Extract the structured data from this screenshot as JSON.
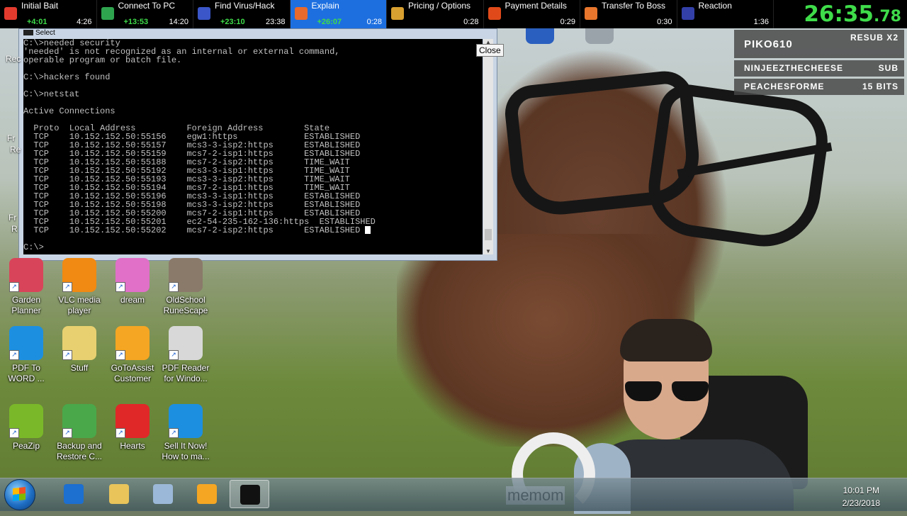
{
  "splits": [
    {
      "name": "Initial Bait",
      "delta": "+4:01",
      "time": "4:26",
      "icon_color": "#e23b2e"
    },
    {
      "name": "Connect To PC",
      "delta": "+13:53",
      "time": "14:20",
      "icon_color": "#2fa44f"
    },
    {
      "name": "Find Virus/Hack",
      "delta": "+23:10",
      "time": "23:38",
      "icon_color": "#3a56c8"
    },
    {
      "name": "Explain",
      "delta": "+26:07",
      "time": "0:28",
      "icon_color": "#e86a2c"
    },
    {
      "name": "Pricing / Options",
      "delta": "",
      "time": "0:28",
      "icon_color": "#d8a030"
    },
    {
      "name": "Payment Details",
      "delta": "",
      "time": "0:29",
      "icon_color": "#e04a1a"
    },
    {
      "name": "Transfer To Boss",
      "delta": "",
      "time": "0:30",
      "icon_color": "#e8762c"
    },
    {
      "name": "Reaction",
      "delta": "",
      "time": "1:36",
      "icon_color": "#3340a8"
    }
  ],
  "active_split_index": 3,
  "timer": {
    "main": "26:35",
    "centis": ".78"
  },
  "subs": [
    {
      "user": "PIKO610",
      "type": "RESUB X2"
    },
    {
      "user": "NINJEEZTHECHEESE",
      "type": "SUB"
    },
    {
      "user": "PEACHESFORME",
      "type": "15 BITS"
    }
  ],
  "cmd": {
    "title": "Select",
    "lines": [
      "C:\\>needed security",
      "'needed' is not recognized as an internal or external command,",
      "operable program or batch file.",
      "",
      "C:\\>hackers found",
      "",
      "C:\\>netstat",
      "",
      "Active Connections",
      "",
      "  Proto  Local Address          Foreign Address        State",
      "  TCP    10.152.152.50:55156    egw1:https             ESTABLISHED",
      "  TCP    10.152.152.50:55157    mcs3-3-isp2:https      ESTABLISHED",
      "  TCP    10.152.152.50:55159    mcs7-2-isp1:https      ESTABLISHED",
      "  TCP    10.152.152.50:55188    mcs7-2-isp2:https      TIME_WAIT",
      "  TCP    10.152.152.50:55192    mcs3-3-isp1:https      TIME_WAIT",
      "  TCP    10.152.152.50:55193    mcs3-3-isp2:https      TIME_WAIT",
      "  TCP    10.152.152.50:55194    mcs7-2-isp1:https      TIME_WAIT",
      "  TCP    10.152.152.50:55196    mcs3-3-isp1:https      ESTABLISHED",
      "  TCP    10.152.152.50:55198    mcs3-3-isp2:https      ESTABLISHED",
      "  TCP    10.152.152.50:55200    mcs7-2-isp1:https      ESTABLISHED",
      "  TCP    10.152.152.50:55201    ec2-54-235-162-136:https  ESTABLISHED",
      "  TCP    10.152.152.50:55202    mcs7-2-isp2:https      ESTABLISHED ",
      "",
      "C:\\>"
    ],
    "close_tooltip": "Close"
  },
  "desktop_icons": [
    {
      "label": "Garden Planner",
      "color": "#d8455a"
    },
    {
      "label": "VLC media player",
      "color": "#f08a12"
    },
    {
      "label": "dream",
      "color": "#e070c8"
    },
    {
      "label": "OldSchool RuneScape",
      "color": "#8a7a6a"
    },
    {
      "label": "PDF To WORD ...",
      "color": "#1d8fe0"
    },
    {
      "label": "Stuff",
      "color": "#e8d070"
    },
    {
      "label": "GoToAssist Customer",
      "color": "#f5a623"
    },
    {
      "label": "PDF Reader for Windo...",
      "color": "#d8d8d8"
    },
    {
      "label": "PeaZip",
      "color": "#7ab829"
    },
    {
      "label": "Backup and Restore C...",
      "color": "#4aa84a"
    },
    {
      "label": "Hearts",
      "color": "#e02828"
    },
    {
      "label": "Sell It Now! How to ma...",
      "color": "#1d8fe0"
    }
  ],
  "edge_labels": [
    "Rec",
    "Fr",
    "Re",
    "Fr",
    "R"
  ],
  "webcam_overlay": "memom",
  "clock": {
    "time": "10:01 PM",
    "date": "2/23/2018"
  },
  "taskbar_icons": [
    {
      "name": "ie-icon",
      "color": "#1d6fd0"
    },
    {
      "name": "explorer-icon",
      "color": "#e8c45a"
    },
    {
      "name": "calculator-icon",
      "color": "#9bb8d8"
    },
    {
      "name": "gotoassist-icon",
      "color": "#f5a623"
    },
    {
      "name": "cmd-icon",
      "color": "#111111"
    }
  ]
}
